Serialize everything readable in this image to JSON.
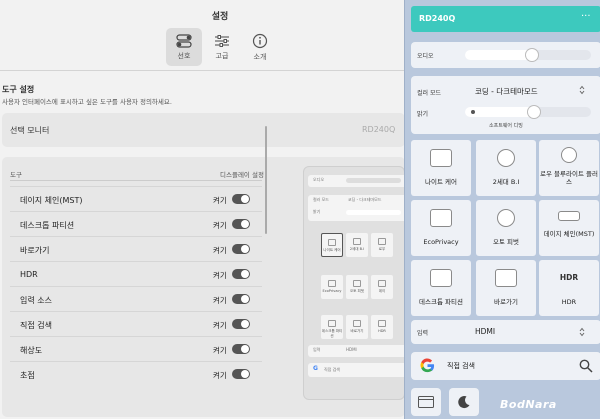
{
  "window": {
    "title": "설정"
  },
  "tabs": [
    {
      "label": "선호",
      "icon": "toggle-icon",
      "active": true
    },
    {
      "label": "고급",
      "icon": "sliders-icon",
      "active": false
    },
    {
      "label": "소개",
      "icon": "info-icon",
      "active": false
    }
  ],
  "tool_settings": {
    "title": "도구 설정",
    "description": "사용자 인터페이스에 표시하고 싶은 도구를 사용자 정의하세요.",
    "monitor_label": "선택 모니터",
    "monitor_value": "RD240Q",
    "col_tool": "도구",
    "col_display": "디스플레이 설정",
    "rows": [
      {
        "name": "데이지 체인(MST)",
        "state": "켜기"
      },
      {
        "name": "데스크톱 파티션",
        "state": "켜기"
      },
      {
        "name": "바로가기",
        "state": "켜기"
      },
      {
        "name": "HDR",
        "state": "켜기"
      },
      {
        "name": "입력 소스",
        "state": "켜기"
      },
      {
        "name": "직접 검색",
        "state": "켜기"
      },
      {
        "name": "해상도",
        "state": "켜기"
      },
      {
        "name": "초점",
        "state": "켜기"
      }
    ]
  },
  "mini_preview": {
    "audio_label": "오디오",
    "color_label": "컬러 모드",
    "color_value": "코딩 - 다크테마모드",
    "brightness_label": "밝기",
    "tiles": [
      "나이트 케어",
      "2세대 B.I",
      "로우",
      "EcoPrivacy",
      "오토 피벗",
      "데이",
      "데스크톱 파티션",
      "바로가기",
      "HDR"
    ],
    "input_label": "입력",
    "input_value": "HDMI",
    "search_text": "직접 검색"
  },
  "panel": {
    "title": "RD240Q",
    "more": "···",
    "audio_label": "오디오",
    "color_mode_label": "컬러 모드",
    "color_mode_value": "코딩 - 다크테마모드",
    "brightness_label": "밝기",
    "brightness_hint": "소프트웨어 디밍",
    "audio_level": 0.53,
    "brightness_level": 0.55,
    "tiles": [
      {
        "label": "나이트 케어",
        "icon": "night-care-icon"
      },
      {
        "label": "2세대 B.I",
        "icon": "brightness-intelligence-icon"
      },
      {
        "label": "로우 블루라이트 플러스",
        "icon": "low-blue-light-icon"
      },
      {
        "label": "EcoPrivacy",
        "icon": "eco-privacy-icon"
      },
      {
        "label": "오토 피벗",
        "icon": "auto-pivot-icon"
      },
      {
        "label": "데이지 체인(MST)",
        "icon": "daisy-chain-icon"
      },
      {
        "label": "데스크톱 파티션",
        "icon": "desktop-partition-icon"
      },
      {
        "label": "바로가기",
        "icon": "shortcut-icon"
      },
      {
        "label": "HDR",
        "icon": "hdr-icon"
      }
    ],
    "input_label": "입력",
    "input_value": "HDMI",
    "search_text": "직접 검색"
  },
  "watermark": "BodNara"
}
